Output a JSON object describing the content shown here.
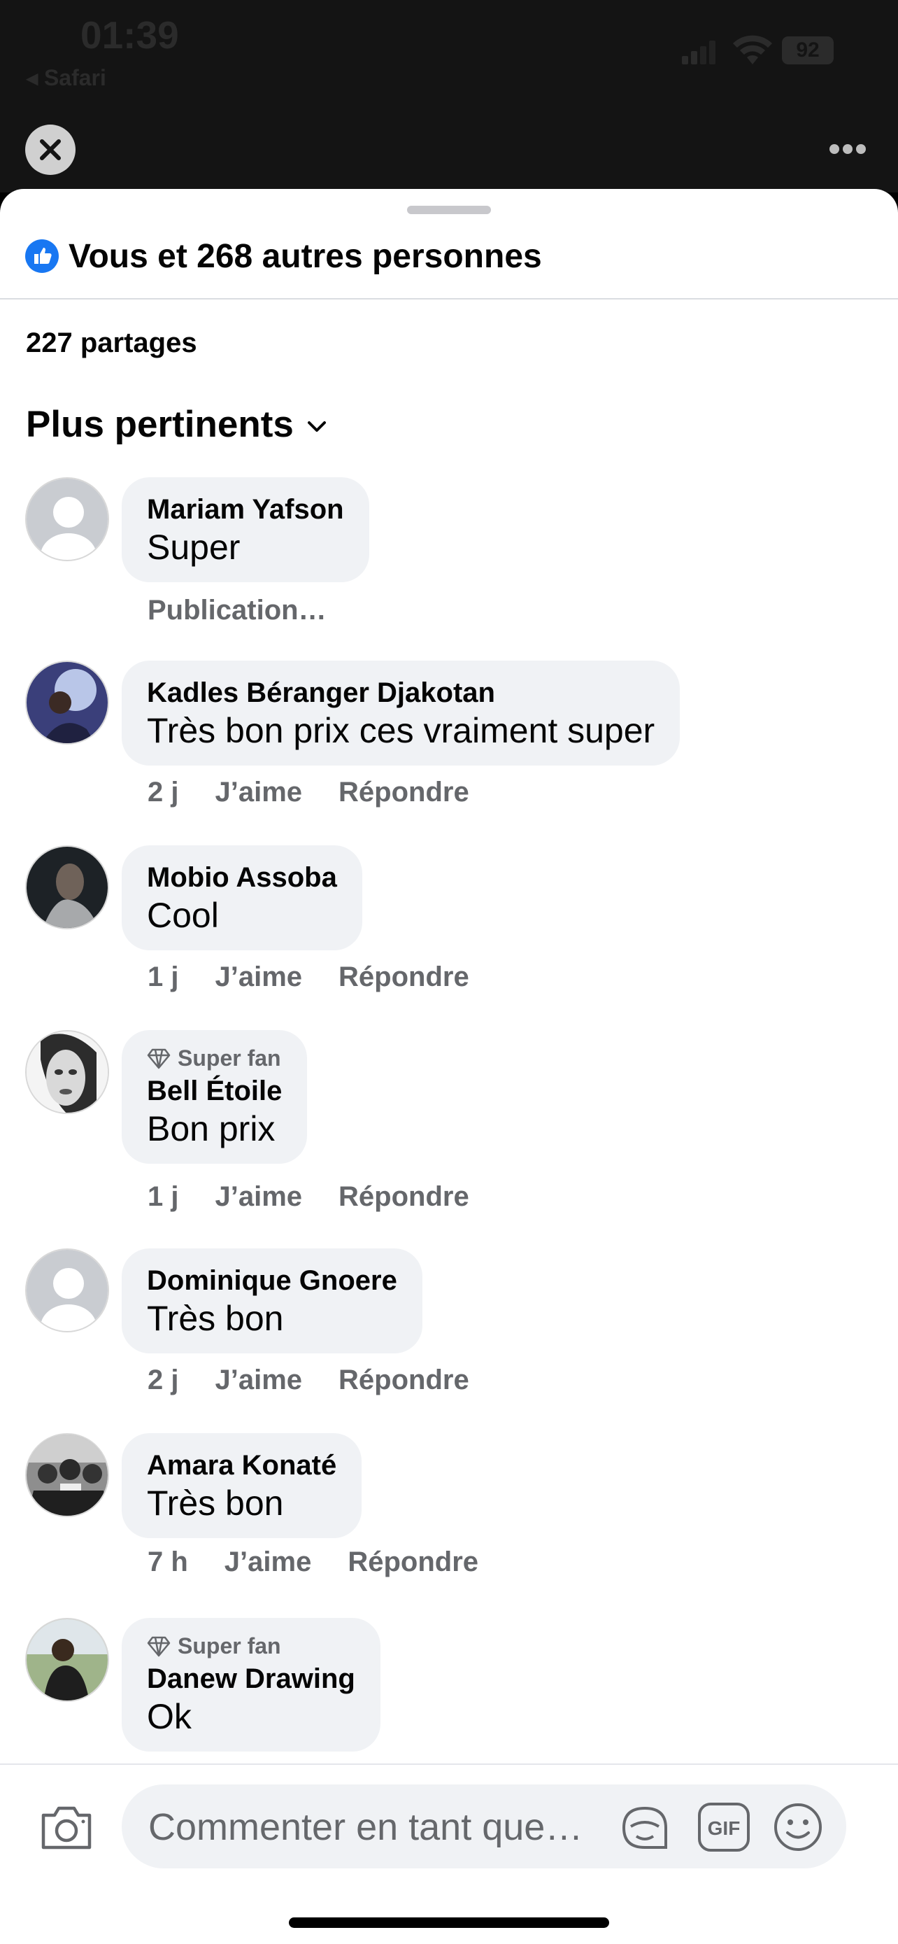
{
  "status_bar": {
    "time": "01:39",
    "back_label": "◂ Safari",
    "battery": "92"
  },
  "reactions": {
    "summary": "Vous et 268 autres personnes"
  },
  "shares": "227 partages",
  "sort": {
    "label": "Plus pertinents"
  },
  "comments": [
    {
      "author": "Mariam Yafson",
      "text": "Super",
      "meta_status": "Publication…"
    },
    {
      "author": "Kadles Béranger Djakotan",
      "text": "Très bon prix ces vraiment super",
      "time": "2 j",
      "like": "J’aime",
      "reply": "Répondre"
    },
    {
      "author": "Mobio Assoba",
      "text": "Cool",
      "time": "1 j",
      "like": "J’aime",
      "reply": "Répondre"
    },
    {
      "badge": "Super fan",
      "author": "Bell Étoile",
      "text": "Bon prix",
      "time": "1 j",
      "like": "J’aime",
      "reply": "Répondre"
    },
    {
      "author": "Dominique Gnoere",
      "text": "Très bon",
      "time": "2 j",
      "like": "J’aime",
      "reply": "Répondre"
    },
    {
      "author": "Amara Konaté",
      "text": "Très bon",
      "time": "7 h",
      "like": "J’aime",
      "reply": "Répondre"
    },
    {
      "badge": "Super fan",
      "author": "Danew Drawing",
      "text": "Ok"
    }
  ],
  "composer": {
    "placeholder": "Commenter en tant que…",
    "gif_label": "GIF"
  },
  "colors": {
    "bubble": "#f0f2f5",
    "meta": "#65676b",
    "like_blue": "#1877f2",
    "text": "#050505"
  }
}
